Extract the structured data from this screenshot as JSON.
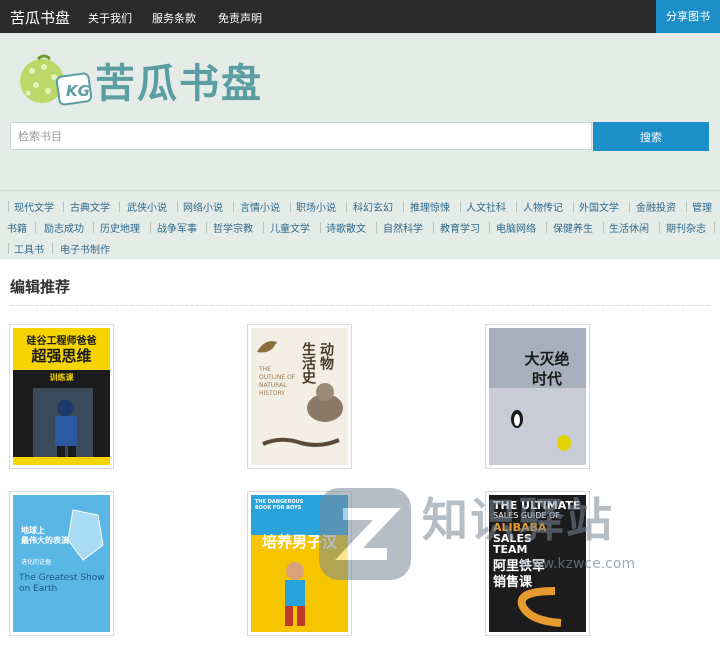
{
  "nav": {
    "brand": "苦瓜书盘",
    "links": [
      "关于我们",
      "服务条款",
      "免责声明"
    ],
    "share": "分享图书"
  },
  "header": {
    "logo_text": "苦瓜书盘",
    "logo_badge": "KG",
    "search_placeholder": "检索书目",
    "search_button": "搜索"
  },
  "categories": [
    "现代文学",
    "古典文学",
    "武侠小说",
    "网络小说",
    "言情小说",
    "职场小说",
    "科幻玄幻",
    "推理惊悚",
    "人文社科",
    "人物传记",
    "外国文学",
    "金融投资",
    "管理",
    "书籍",
    "励志成功",
    "历史地理",
    "战争军事",
    "哲学宗教",
    "儿童文学",
    "诗歌散文",
    "自然科学",
    "教育学习",
    "电脑网络",
    "保健养生",
    "生活休闲",
    "期刊杂志",
    "工具书",
    "电子书制作"
  ],
  "section_title": "编辑推荐",
  "books": [
    {
      "lines": [
        "硅谷工程师爸爸",
        "超强思维",
        "训练课"
      ],
      "colors": {
        "bg": "#1b1b1b",
        "accent": "#f5d400",
        "text": "#1b1b1b"
      }
    },
    {
      "lines": [
        "动物",
        "生活史",
        "THE OUTLINE OF NATURAL HISTORY"
      ],
      "colors": {
        "bg": "#f3efe4",
        "text": "#4a3b2a"
      }
    },
    {
      "lines": [
        "大灭绝",
        "时代"
      ],
      "colors": {
        "bg": "#c9ccd6",
        "text": "#1a1a1a",
        "accent": "#e3d400"
      }
    },
    {
      "lines": [
        "地球上",
        "最伟大的表演",
        "进化的证据",
        "The Greatest Show on Earth"
      ],
      "colors": {
        "bg": "#5ab6e4",
        "text": "#ffffff"
      }
    },
    {
      "lines": [
        "培养男子汉",
        "THE DANGEROUS BOOK FOR BOYS"
      ],
      "colors": {
        "bg": "#f6c500",
        "text": "#ffffff",
        "accent": "#2aa3dc"
      }
    },
    {
      "lines": [
        "THE ULTIMATE",
        "SALES GUIDE OF",
        "ALIBABA",
        "SALES",
        "TEAM",
        "阿里铁军",
        "销售课"
      ],
      "colors": {
        "bg": "#1c1c1c",
        "text": "#ffffff",
        "accent": "#e79b2f"
      }
    }
  ],
  "watermark": {
    "text": "知识驿站",
    "url": "www.kzwce.com"
  }
}
